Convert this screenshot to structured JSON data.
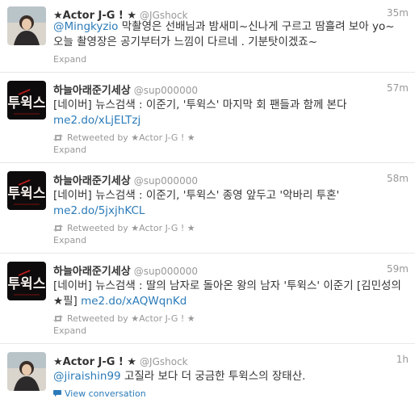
{
  "tweets": [
    {
      "fullname": "★Actor J-G ! ★",
      "screen_name": "@JGshock",
      "time": "35m",
      "mention": "@Mingkyzio",
      "text": " 막촬영은 선배님과 밤새미~신나게 구르고 땀흘려 보아 yo~  오늘 촬영장은 공기부터가 느낌이 다르네 . 기분탓이겠죠~",
      "expand": "Expand"
    },
    {
      "fullname": "하늘아래준기세상",
      "screen_name": "@sup000000",
      "time": "57m",
      "text": "[네이버] 뉴스검색 : 이준기, '투윅스' 마지막 회 팬들과 함께 본다",
      "link": "me2.do/xLjELTzj",
      "retweeted": "Retweeted by ★Actor J-G ! ★",
      "expand": "Expand"
    },
    {
      "fullname": "하늘아래준기세상",
      "screen_name": "@sup000000",
      "time": "58m",
      "text": "[네이버] 뉴스검색 : 이준기, '투윅스' 종영 앞두고 '악바리 투혼'",
      "link": "me2.do/5jxjhKCL",
      "retweeted": "Retweeted by ★Actor J-G ! ★",
      "expand": "Expand"
    },
    {
      "fullname": "하늘아래준기세상",
      "screen_name": "@sup000000",
      "time": "59m",
      "text": "[네이버] 뉴스검색 : 딸의 남자로 돌아온 왕의 남자 '투윅스' 이준기 [김민성의 ★필]",
      "link": "me2.do/xAQWqnKd",
      "retweeted": "Retweeted by ★Actor J-G ! ★",
      "expand": "Expand"
    },
    {
      "fullname": "★Actor J-G ! ★",
      "screen_name": "@JGshock",
      "time": "1h",
      "mention": "@jiraishin99",
      "text": " 고질라 보다 더 궁금한 투윅스의 장태산.",
      "view_conversation": "View conversation"
    }
  ],
  "avatar_posters": {
    "title_glyphs": "투윅스"
  },
  "colors": {
    "link": "#2b7bb9",
    "meta": "#999999",
    "divider": "#e8e8e8"
  }
}
